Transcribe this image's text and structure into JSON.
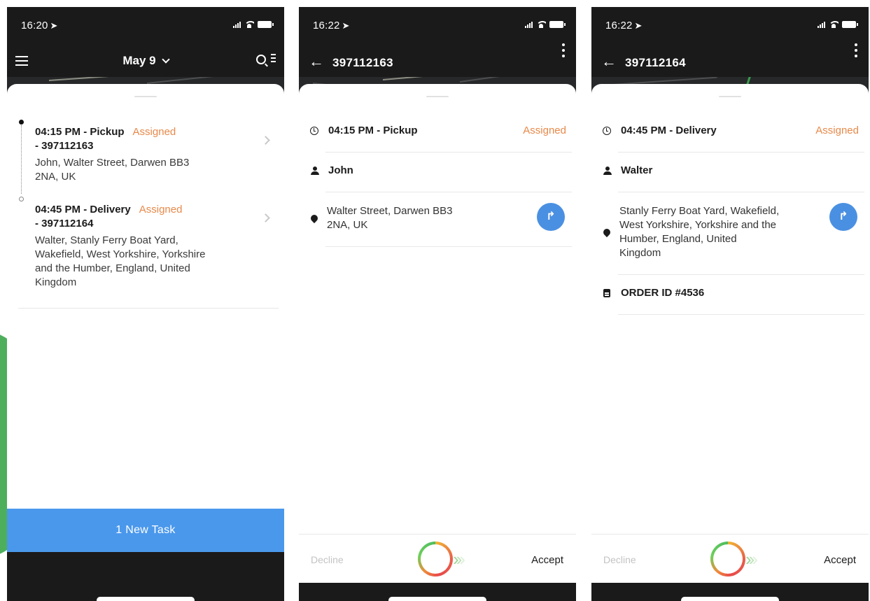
{
  "colors": {
    "accent_blue": "#4a98ec",
    "status_orange": "#e8894a",
    "dark_header": "#1a1a1a"
  },
  "screens": [
    {
      "status_bar": {
        "time": "16:20"
      },
      "header": {
        "date_label": "May 9"
      },
      "tasks": [
        {
          "title": "04:15 PM - Pickup",
          "status": "Assigned",
          "id_line": "- 397112163",
          "address_line1": "John, Walter Street, Darwen BB3",
          "address_line2": "2NA, UK"
        },
        {
          "title": "04:45 PM - Delivery",
          "status": "Assigned",
          "id_line": "- 397112164",
          "address_line1": "Walter, Stanly Ferry Boat Yard,",
          "address_line2": "Wakefield, West Yorkshire, Yorkshire",
          "address_line3": "and the Humber, England, United",
          "address_line4": "Kingdom"
        }
      ],
      "new_task_label": "1  New Task"
    },
    {
      "status_bar": {
        "time": "16:22"
      },
      "header": {
        "task_id": "397112163"
      },
      "detail": {
        "time_label": "04:15 PM - Pickup",
        "status": "Assigned",
        "contact_name": "John",
        "address_line1": "Walter Street, Darwen BB3",
        "address_line2": "2NA, UK"
      },
      "actions": {
        "decline": "Decline",
        "accept": "Accept"
      }
    },
    {
      "status_bar": {
        "time": "16:22"
      },
      "header": {
        "task_id": "397112164"
      },
      "detail": {
        "time_label": "04:45 PM - Delivery",
        "status": "Assigned",
        "contact_name": "Walter",
        "address_line1": "Stanly Ferry Boat Yard, Wakefield,",
        "address_line2": "West Yorkshire, Yorkshire and the",
        "address_line3": "Humber, England, United",
        "address_line4": "Kingdom",
        "order_id": "ORDER ID #4536"
      },
      "actions": {
        "decline": "Decline",
        "accept": "Accept"
      }
    }
  ]
}
